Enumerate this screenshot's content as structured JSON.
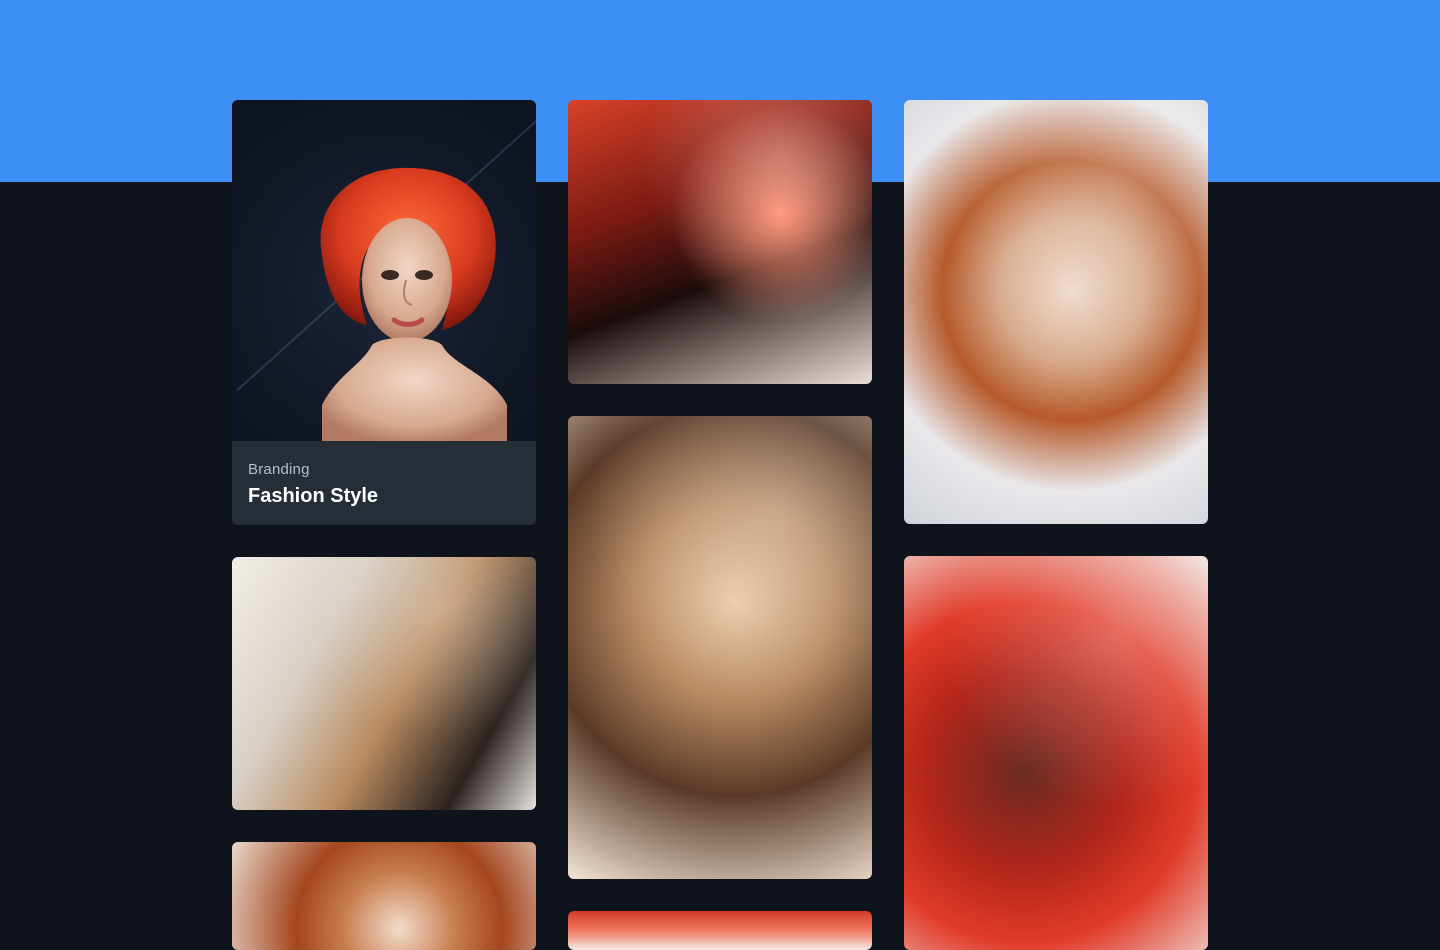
{
  "theme": {
    "page_background": "#0e131c",
    "accent_band": "#3d8ff5",
    "card_footer": "#252d37"
  },
  "gallery": {
    "featured": {
      "category": "Branding",
      "title": "Fashion Style"
    }
  }
}
